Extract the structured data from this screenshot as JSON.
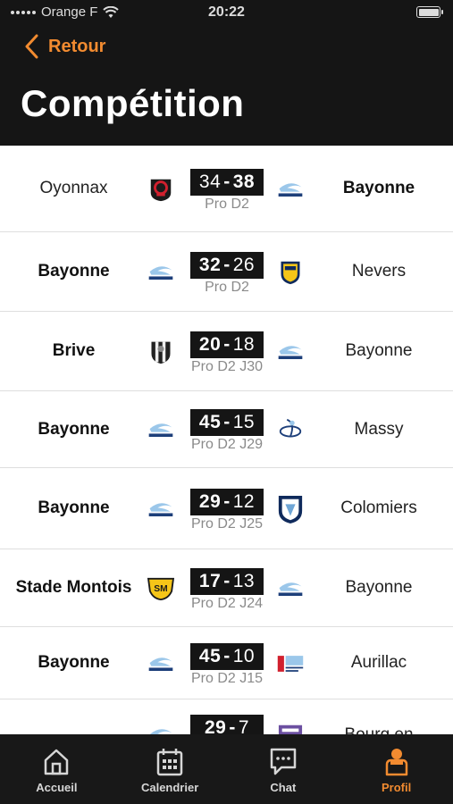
{
  "status": {
    "carrier": "Orange F",
    "time": "20:22"
  },
  "header": {
    "back_label": "Retour",
    "title": "Compétition"
  },
  "matches": [
    {
      "home": "Oyonnax",
      "away": "Bayonne",
      "home_score": "34",
      "away_score": "38",
      "competition": "Pro D2",
      "winner": "away",
      "home_logo": "oyonnax-logo-icon",
      "away_logo": "bayonne-logo-icon"
    },
    {
      "home": "Bayonne",
      "away": "Nevers",
      "home_score": "32",
      "away_score": "26",
      "competition": "Pro D2",
      "winner": "home",
      "home_logo": "bayonne-logo-icon",
      "away_logo": "nevers-logo-icon"
    },
    {
      "home": "Brive",
      "away": "Bayonne",
      "home_score": "20",
      "away_score": "18",
      "competition": "Pro D2 J30",
      "winner": "home",
      "home_logo": "brive-logo-icon",
      "away_logo": "bayonne-logo-icon"
    },
    {
      "home": "Bayonne",
      "away": "Massy",
      "home_score": "45",
      "away_score": "15",
      "competition": "Pro D2 J29",
      "winner": "home",
      "home_logo": "bayonne-logo-icon",
      "away_logo": "massy-logo-icon"
    },
    {
      "home": "Bayonne",
      "away": "Colomiers",
      "home_score": "29",
      "away_score": "12",
      "competition": "Pro D2 J25",
      "winner": "home",
      "home_logo": "bayonne-logo-icon",
      "away_logo": "colomiers-logo-icon"
    },
    {
      "home": "Stade Montois",
      "away": "Bayonne",
      "home_score": "17",
      "away_score": "13",
      "competition": "Pro D2 J24",
      "winner": "home",
      "home_logo": "stade-montois-logo-icon",
      "away_logo": "bayonne-logo-icon"
    },
    {
      "home": "Bayonne",
      "away": "Aurillac",
      "home_score": "45",
      "away_score": "10",
      "competition": "Pro D2 J15",
      "winner": "home",
      "home_logo": "bayonne-logo-icon",
      "away_logo": "aurillac-logo-icon"
    },
    {
      "home": "",
      "away": "Bourg en",
      "home_score": "29",
      "away_score": "7",
      "competition": "",
      "winner": "home",
      "home_logo": "bayonne-logo-icon",
      "away_logo": "bourg-en-bresse-logo-icon"
    }
  ],
  "tabs": [
    {
      "label": "Accueil",
      "icon": "home-icon",
      "active": false
    },
    {
      "label": "Calendrier",
      "icon": "calendar-icon",
      "active": false
    },
    {
      "label": "Chat",
      "icon": "chat-icon",
      "active": false
    },
    {
      "label": "Profil",
      "icon": "profile-icon",
      "active": true
    }
  ],
  "colors": {
    "accent": "#f28b30",
    "header_bg": "#151515",
    "score_bg": "#151515",
    "competition_text": "#8a8a8a"
  }
}
